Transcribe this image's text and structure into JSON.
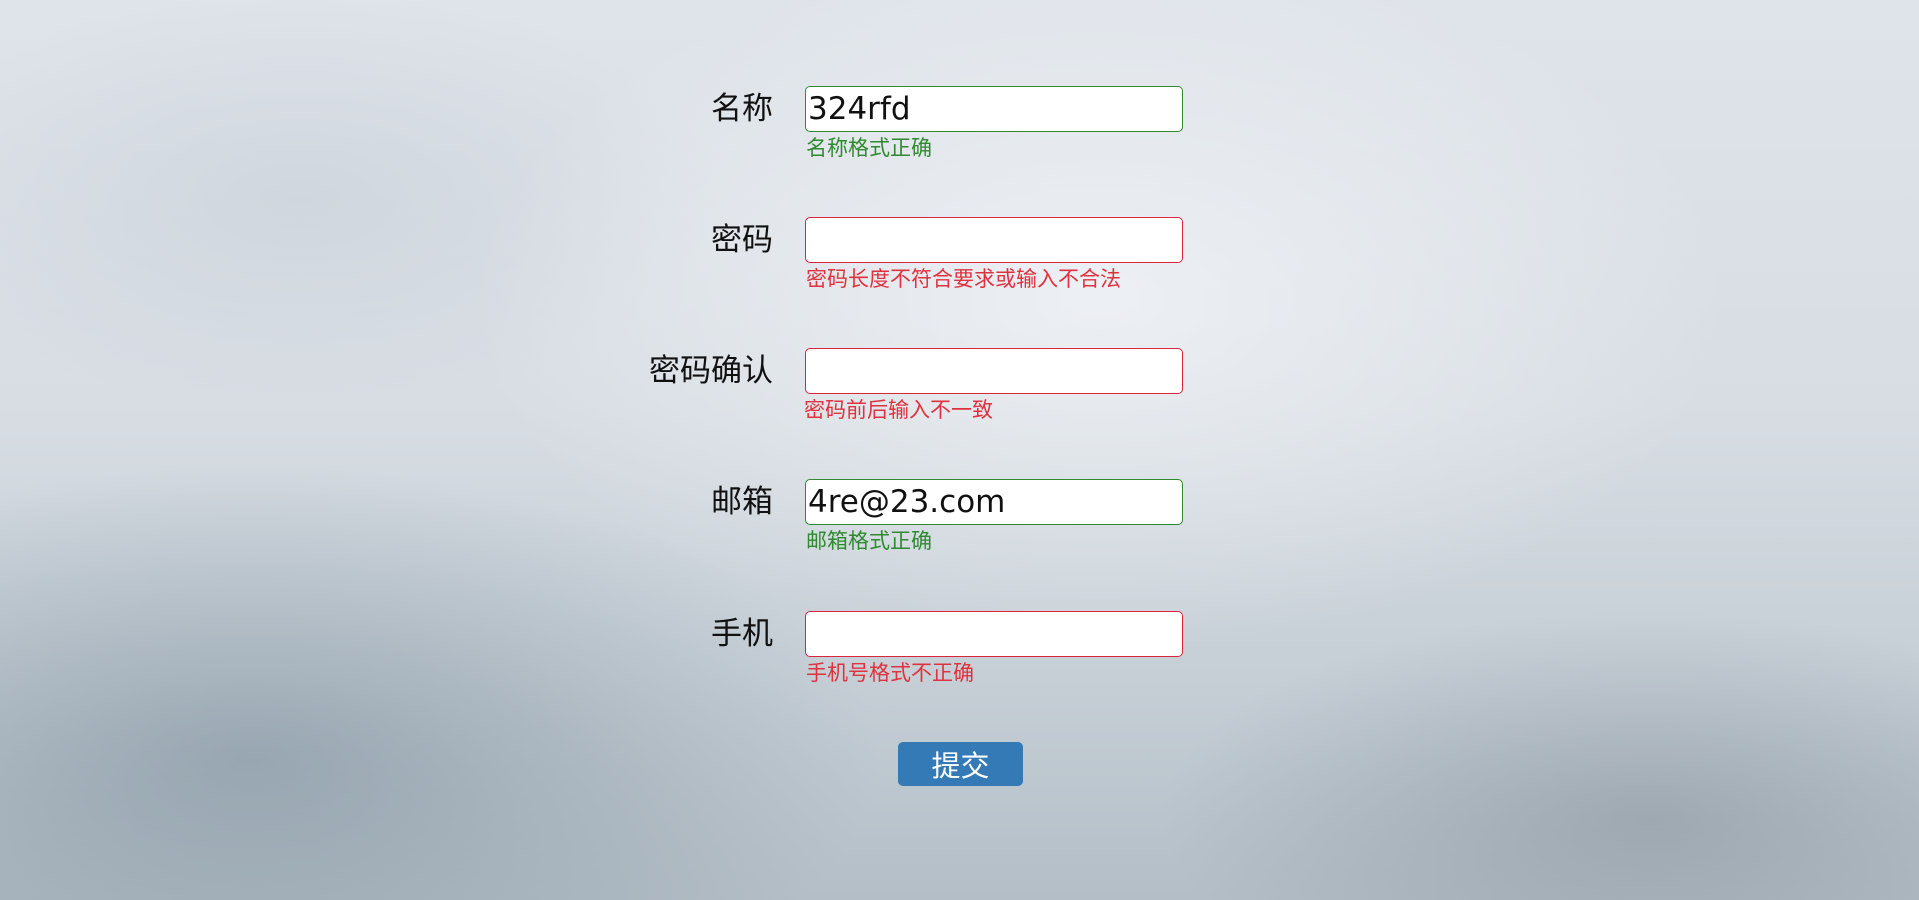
{
  "form": {
    "fields": [
      {
        "label": "名称",
        "value": "324rfd",
        "placeholder": "",
        "status": "ok",
        "message": "名称格式正确"
      },
      {
        "label": "密码",
        "value": "",
        "placeholder": "",
        "status": "bad",
        "message": "密码长度不符合要求或输入不合法"
      },
      {
        "label": "密码确认",
        "value": "",
        "placeholder": "",
        "status": "bad",
        "message": "密码前后输入不一致"
      },
      {
        "label": "邮箱",
        "value": "4re@23.com",
        "placeholder": "",
        "status": "ok",
        "message": "邮箱格式正确"
      },
      {
        "label": "手机",
        "value": "",
        "placeholder": "",
        "status": "bad",
        "message": "手机号格式不正确"
      }
    ],
    "submit_label": "提交"
  },
  "colors": {
    "ok": "#2f8a2f",
    "error": "#e0323e",
    "button": "#337ab7"
  }
}
